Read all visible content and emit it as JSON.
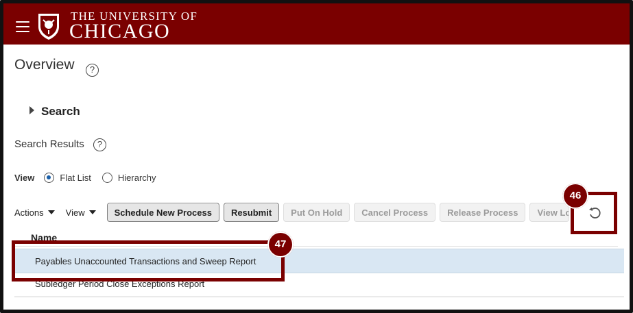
{
  "header": {
    "university_small": "THE UNIVERSITY OF",
    "university_big": "CHICAGO",
    "background_color": "#7a0000",
    "menu_icon": "hamburger-menu-icon",
    "logo_icon": "university-crest-icon"
  },
  "page": {
    "title": "Overview",
    "help_icon": "help-circle-icon"
  },
  "search": {
    "label": "Search",
    "expand_icon": "triangle-right-icon"
  },
  "results": {
    "title": "Search Results",
    "view_label": "View",
    "view_options": [
      {
        "label": "Flat List",
        "selected": true
      },
      {
        "label": "Hierarchy",
        "selected": false
      }
    ]
  },
  "toolbar": {
    "actions_label": "Actions",
    "view_label": "View",
    "buttons": [
      {
        "label": "Schedule New Process",
        "enabled": true
      },
      {
        "label": "Resubmit",
        "enabled": true
      },
      {
        "label": "Put On Hold",
        "enabled": false
      },
      {
        "label": "Cancel Process",
        "enabled": false
      },
      {
        "label": "Release Process",
        "enabled": false
      },
      {
        "label": "View Lo",
        "enabled": false
      }
    ],
    "refresh_icon": "refresh-icon"
  },
  "table": {
    "columns": [
      "Name"
    ],
    "rows": [
      {
        "name": "Payables Unaccounted Transactions and Sweep Report",
        "selected": true
      },
      {
        "name": "Subledger Period Close Exceptions Report",
        "selected": false
      }
    ]
  },
  "callouts": {
    "step_46": "46",
    "step_47": "47",
    "accent_color": "#7a0000"
  }
}
